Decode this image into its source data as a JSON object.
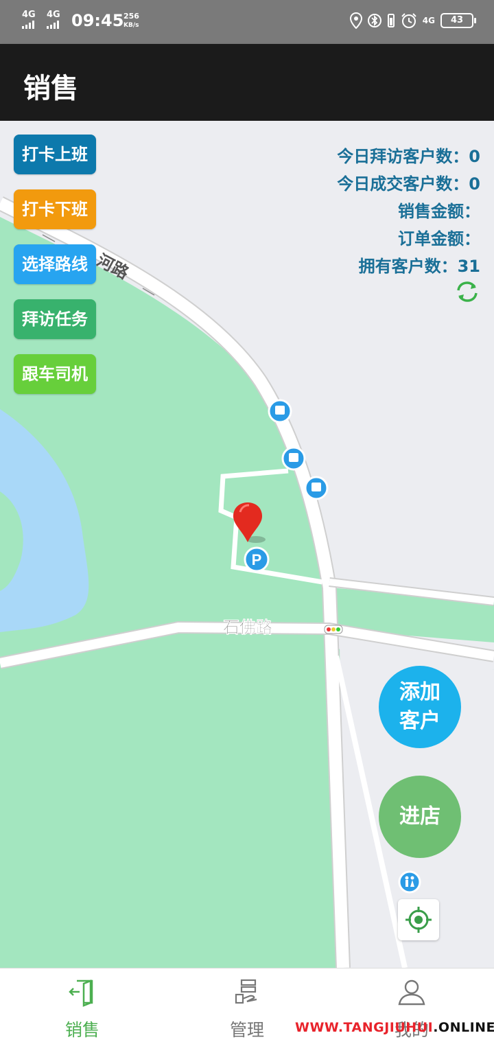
{
  "status_bar": {
    "signal_1": "4G",
    "signal_2": "4G",
    "time": "09:45",
    "speed_value": "256",
    "speed_unit": "KB/s",
    "network": "4G",
    "battery": "43",
    "icons": [
      "location-icon",
      "bluetooth-icon",
      "vibrate-icon",
      "alarm-icon"
    ]
  },
  "header": {
    "title": "销售"
  },
  "left_buttons": [
    {
      "label": "打卡上班",
      "color": "#0d79ac"
    },
    {
      "label": "打卡下班",
      "color": "#f29a0e"
    },
    {
      "label": "选择路线",
      "color": "#27a4f0"
    },
    {
      "label": "拜访任务",
      "color": "#38b26d"
    },
    {
      "label": "跟车司机",
      "color": "#67cf3b"
    }
  ],
  "stats": {
    "visit_label": "今日拜访客户数：",
    "visit_value": "0",
    "deal_label": "今日成交客户数：",
    "deal_value": "0",
    "sales_label": "销售金额：",
    "sales_value": "",
    "order_label": "订单金额：",
    "order_value": "",
    "customers_label": "拥有客户数：",
    "customers_value": "31"
  },
  "map": {
    "road_label_1": "河路",
    "road_label_2": "石佛路",
    "parking_label": "P",
    "land_color": "#a3e6bf",
    "water_color": "#a9d8f8",
    "background_color": "#ecedf1"
  },
  "fabs": {
    "add_customer": "添加\n客户",
    "add_customer_color": "#1cb2ec",
    "enter_store": "进店",
    "enter_store_color": "#6fbf73"
  },
  "bottom_nav": {
    "tabs": [
      {
        "label": "销售",
        "icon": "exit-door-icon",
        "active": true
      },
      {
        "label": "管理",
        "icon": "manage-stack-icon",
        "active": false
      },
      {
        "label": "我的",
        "icon": "person-icon",
        "active": false
      }
    ],
    "active_color": "#4caf50",
    "inactive_color": "#777777"
  },
  "watermark": {
    "red": "WWW.TANGJIUHUI",
    "black": ".ONLINE"
  }
}
